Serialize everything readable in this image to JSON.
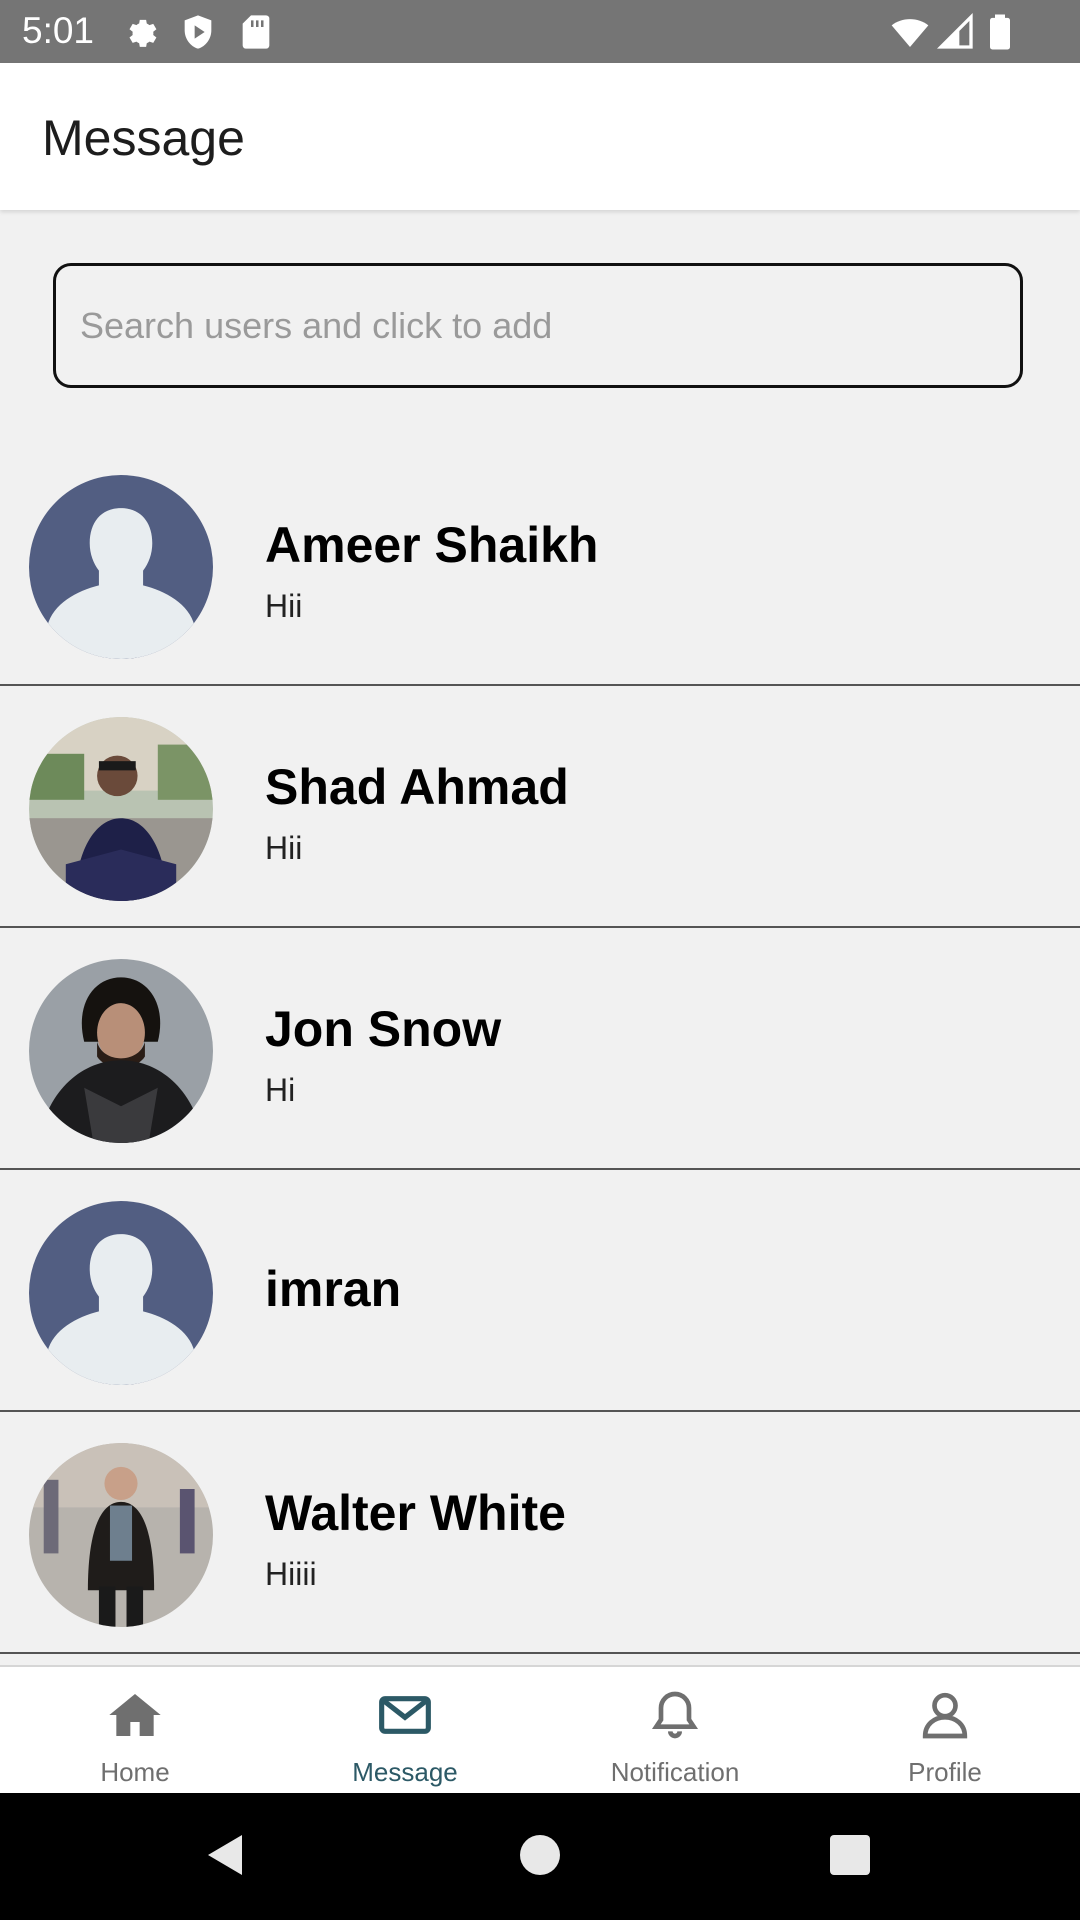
{
  "status_bar": {
    "time": "5:01",
    "icons_left": [
      "gear-icon",
      "shield-icon",
      "sd-card-icon"
    ],
    "icons_right": [
      "wifi-icon",
      "signal-icon",
      "battery-icon"
    ]
  },
  "app_bar": {
    "title": "Message"
  },
  "search": {
    "placeholder": "Search users and click to add",
    "value": ""
  },
  "conversations": [
    {
      "name": "Ameer Shaikh",
      "last_message": "Hii",
      "avatar": "default-avatar"
    },
    {
      "name": "Shad Ahmad",
      "last_message": "Hii",
      "avatar": "photo-avatar"
    },
    {
      "name": "Jon Snow",
      "last_message": "Hi",
      "avatar": "photo-avatar"
    },
    {
      "name": "imran",
      "last_message": "",
      "avatar": "default-avatar"
    },
    {
      "name": "Walter White",
      "last_message": "Hiiii",
      "avatar": "photo-avatar"
    }
  ],
  "bottom_nav": {
    "items": [
      {
        "label": "Home",
        "icon": "home-icon"
      },
      {
        "label": "Message",
        "icon": "mail-icon",
        "active": true
      },
      {
        "label": "Notification",
        "icon": "bell-icon"
      },
      {
        "label": "Profile",
        "icon": "person-icon"
      }
    ]
  },
  "colors": {
    "status_bar": "#757575",
    "background": "#f1f1f1",
    "accent": "#2c5966",
    "avatar_default": "#525e82"
  }
}
